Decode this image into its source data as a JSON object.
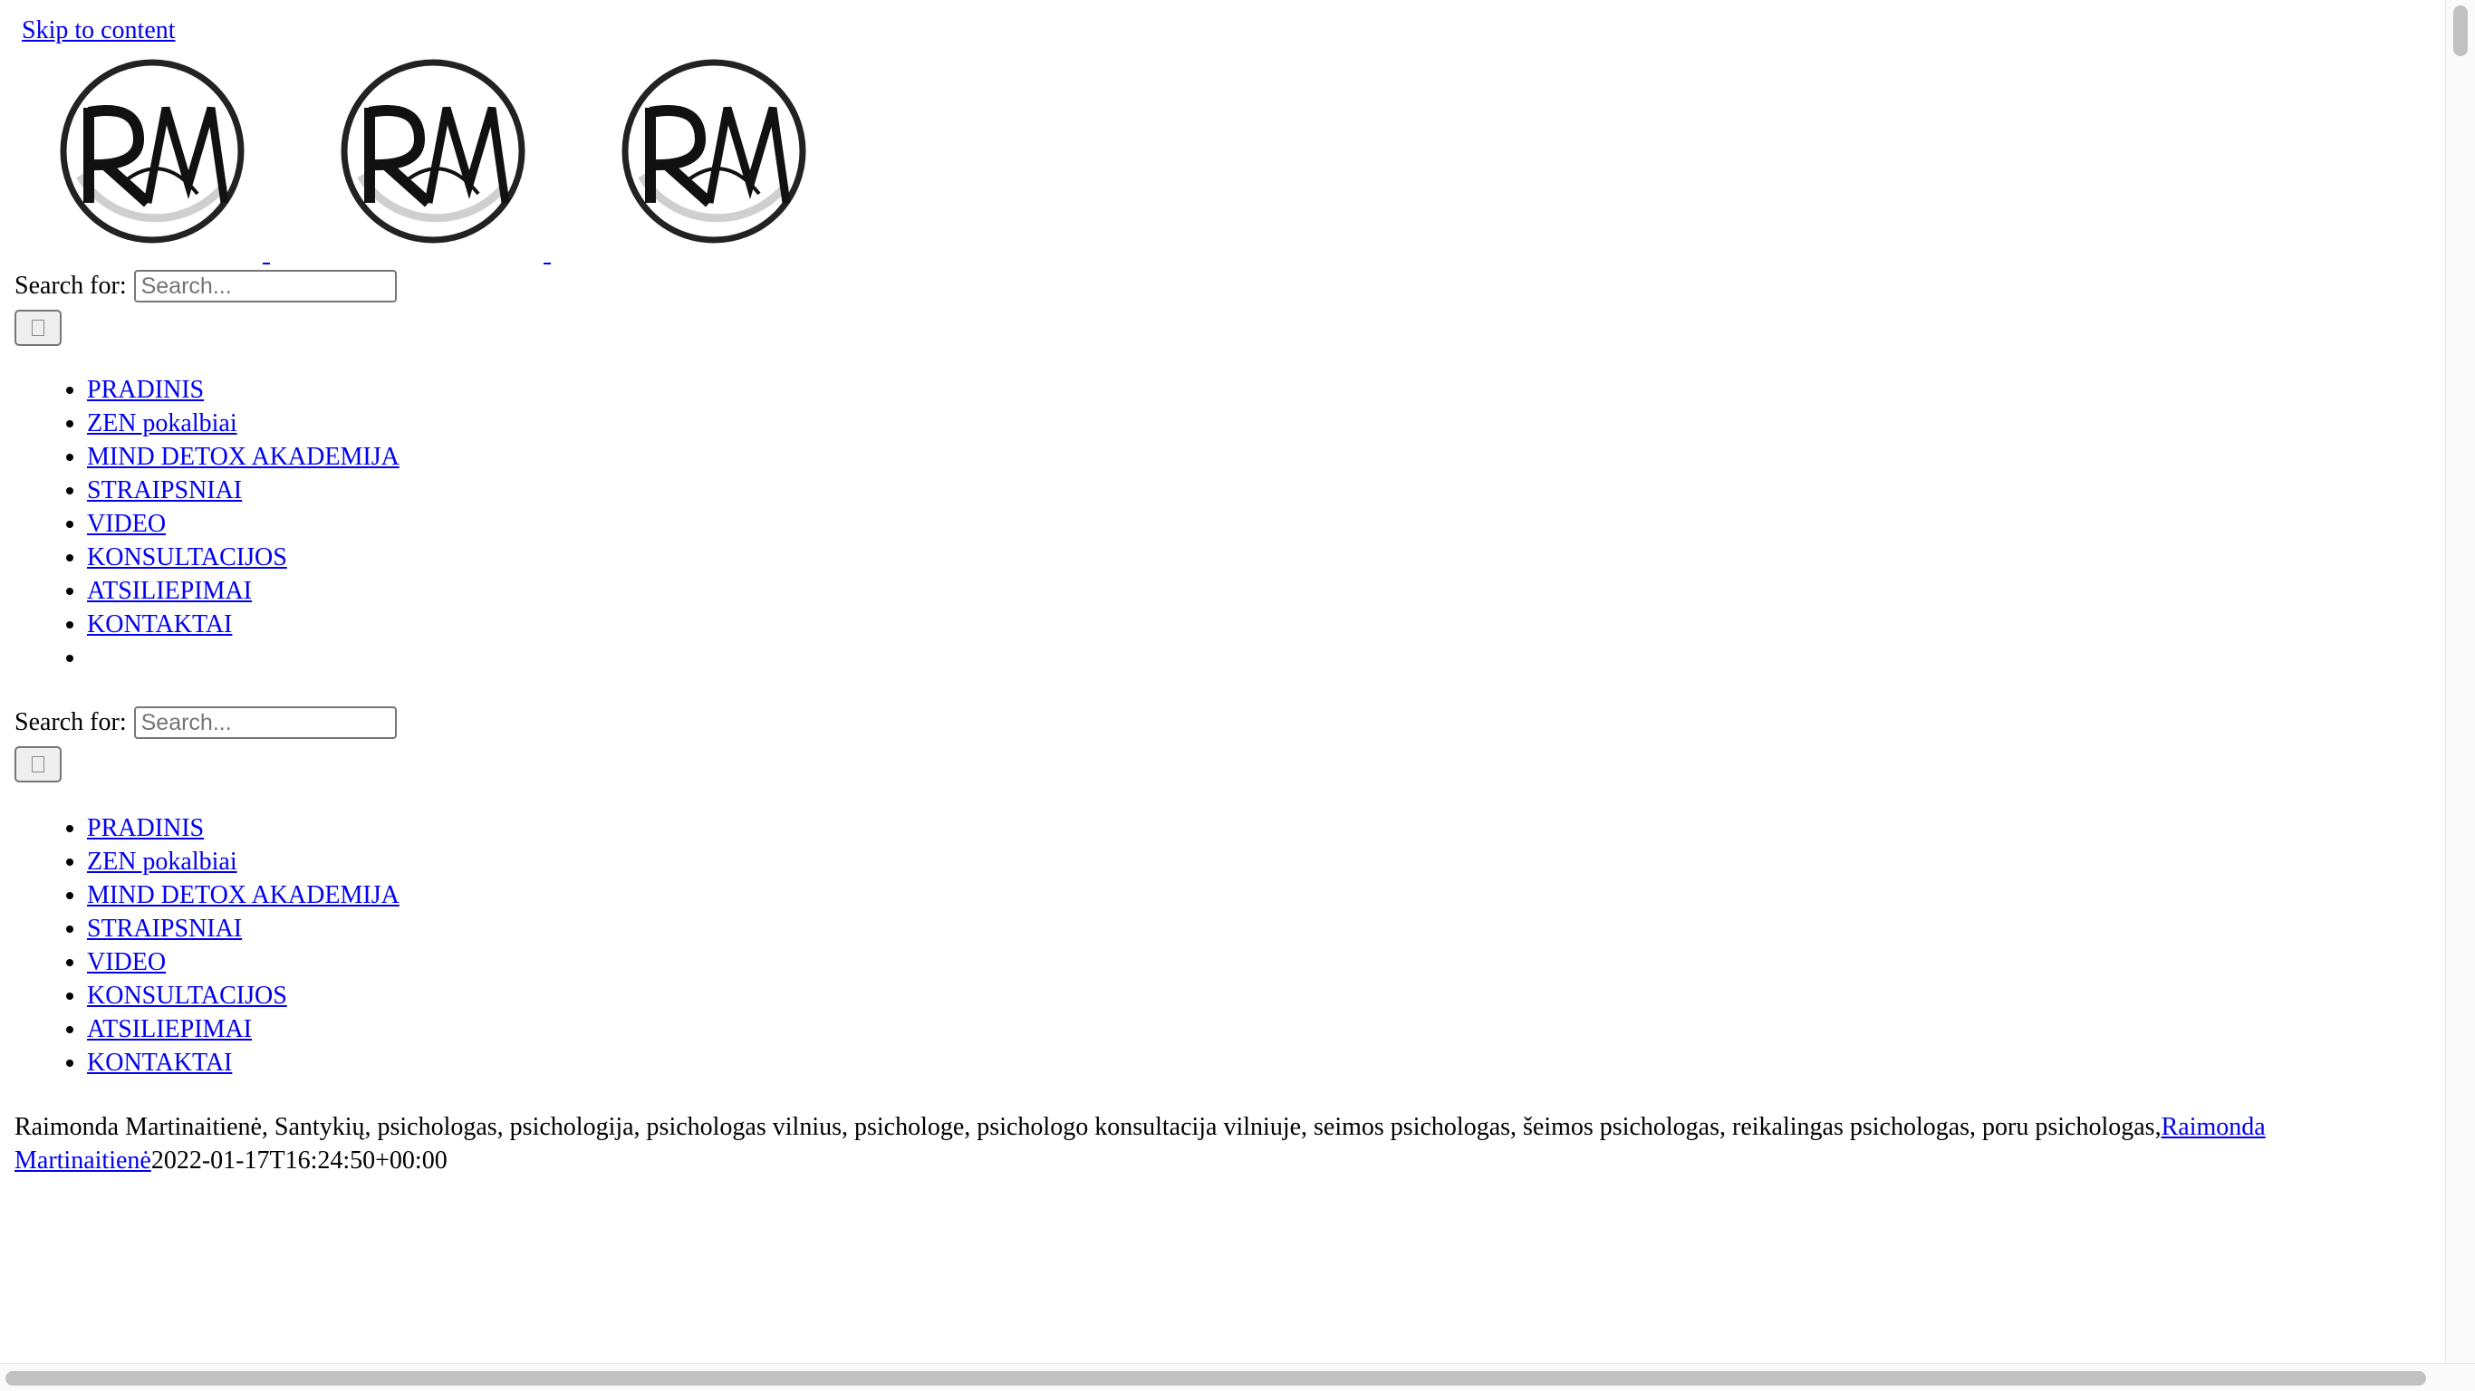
{
  "skip_link": "Skip to content",
  "logos": [
    {
      "name": "logo-rm-1"
    },
    {
      "name": "logo-rm-2"
    },
    {
      "name": "logo-rm-3"
    }
  ],
  "search_top": {
    "label": "Search for:",
    "placeholder": "Search...",
    "button_icon": "search-icon"
  },
  "nav_top": [
    "PRADINIS",
    "ZEN pokalbiai",
    "MIND DETOX AKADEMIJA",
    "STRAIPSNIAI",
    "VIDEO",
    "KONSULTACIJOS",
    "ATSILIEPIMAI",
    "KONTAKTAI",
    ""
  ],
  "search_bottom": {
    "label": "Search for:",
    "placeholder": "Search...",
    "button_icon": "search-icon"
  },
  "nav_bottom": [
    "PRADINIS",
    "ZEN pokalbiai",
    "MIND DETOX AKADEMIJA",
    "STRAIPSNIAI",
    "VIDEO",
    "KONSULTACIJOS",
    "ATSILIEPIMAI",
    "KONTAKTAI"
  ],
  "post": {
    "tags": "Raimonda Martinaitienė, Santykių, psichologas, psichologija, psichologas vilnius, psichologe, psichologo konsultacija vilniuje, seimos psichologas, šeimos psichologas, reikalingas psichologas, poru psichologas,",
    "author": "Raimonda Martinaitienė",
    "date": "2022-01-17T16:24:50+00:00"
  },
  "colors": {
    "link": "#0000ee",
    "text": "#000000",
    "background": "#ffffff"
  }
}
